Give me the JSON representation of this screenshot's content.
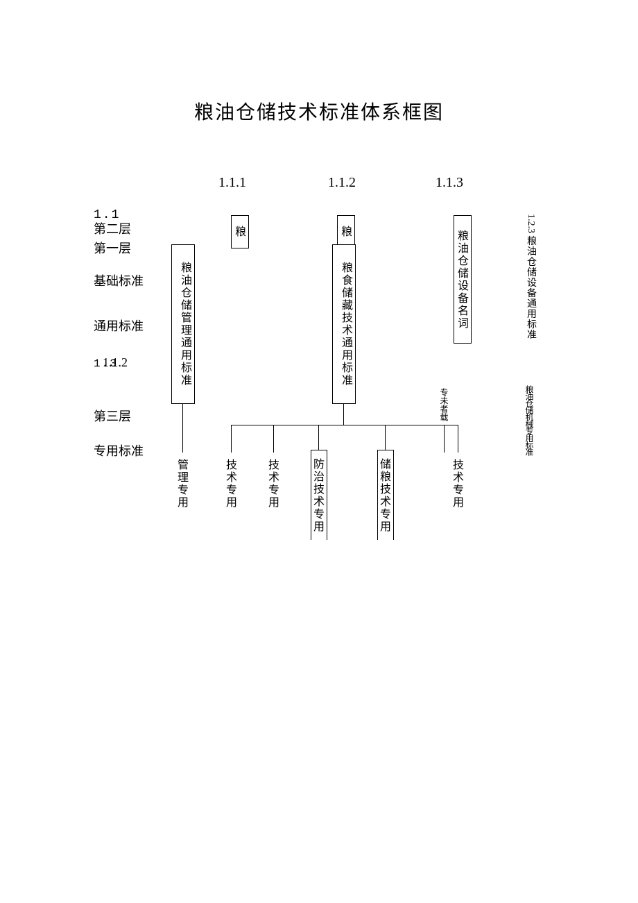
{
  "title": "粮油仓储技术标准体系框图",
  "header_numbers": {
    "n1": "1.1.1",
    "n2": "1.1.2",
    "n3": "1.1.3"
  },
  "left_labels": {
    "l1_num": "1.1",
    "l2": "第二层",
    "l1": "第一层",
    "base": "基础标准",
    "common": "通用标准",
    "l12": "1.1.2",
    "l13_overlap": "1.3",
    "l3": "第三层",
    "special": "专用标准"
  },
  "boxes": {
    "b_left_main": "粮油仓储管理通用标准",
    "b_top_1": "粮油",
    "b_top_2": "粮油",
    "b_center_main": "粮食储藏技术通用标准",
    "b_top_3": "粮油仓储设备名词"
  },
  "side_right": {
    "num": "1.2.3",
    "text": "粮油仓储设备通用标准",
    "garble": "粮油仓储机械专用标准"
  },
  "leaves": {
    "c1": "管理专用",
    "c2": "技术专用",
    "c3": "技术专用",
    "c4": "防治技术专用",
    "c5": "储粮技术专用",
    "c6": "技术专用",
    "mid_garble": "专未者载"
  }
}
